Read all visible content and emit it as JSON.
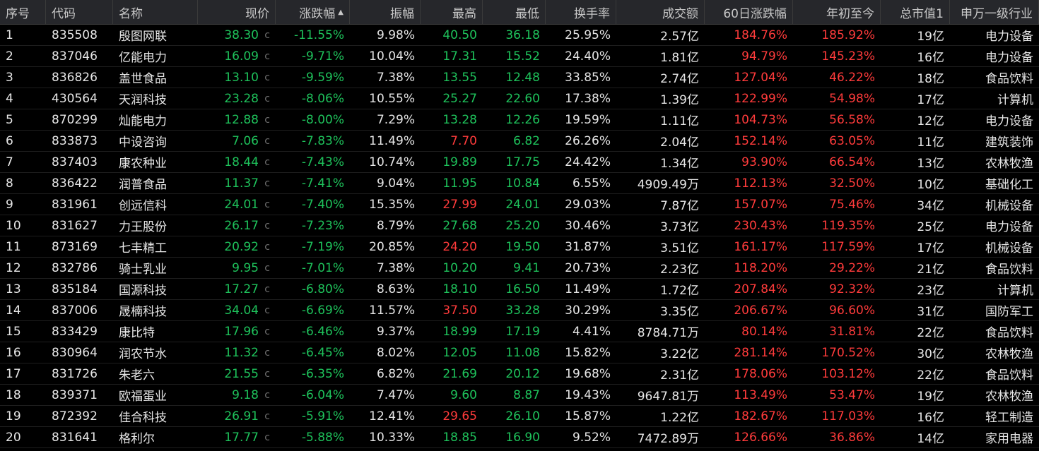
{
  "columns": {
    "idx": "序号",
    "code": "代码",
    "name": "名称",
    "price": "现价",
    "chg": "涨跌幅",
    "amp": "振幅",
    "high": "最高",
    "low": "最低",
    "turn": "换手率",
    "vol": "成交额",
    "d60": "60日涨跌幅",
    "ytd": "年初至今",
    "cap": "总市值1",
    "ind": "申万一级行业"
  },
  "sort_indicator": "▲",
  "price_suffix": "c",
  "rows": [
    {
      "idx": "1",
      "code": "835508",
      "name": "殷图网联",
      "price": "38.30",
      "chg": "-11.55%",
      "amp": "9.98%",
      "high": "40.50",
      "low": "36.18",
      "turn": "25.95%",
      "vol": "2.57亿",
      "d60": "184.76%",
      "ytd": "185.92%",
      "cap": "19亿",
      "ind": "电力设备"
    },
    {
      "idx": "2",
      "code": "837046",
      "name": "亿能电力",
      "price": "16.09",
      "chg": "-9.71%",
      "amp": "10.04%",
      "high": "17.31",
      "low": "15.52",
      "turn": "24.40%",
      "vol": "1.81亿",
      "d60": "94.79%",
      "ytd": "145.23%",
      "cap": "16亿",
      "ind": "电力设备"
    },
    {
      "idx": "3",
      "code": "836826",
      "name": "盖世食品",
      "price": "13.10",
      "chg": "-9.59%",
      "amp": "7.38%",
      "high": "13.55",
      "low": "12.48",
      "turn": "33.85%",
      "vol": "2.74亿",
      "d60": "127.04%",
      "ytd": "46.22%",
      "cap": "18亿",
      "ind": "食品饮料"
    },
    {
      "idx": "4",
      "code": "430564",
      "name": "天润科技",
      "price": "23.28",
      "chg": "-8.06%",
      "amp": "10.55%",
      "high": "25.27",
      "low": "22.60",
      "turn": "17.38%",
      "vol": "1.39亿",
      "d60": "122.99%",
      "ytd": "54.98%",
      "cap": "17亿",
      "ind": "计算机"
    },
    {
      "idx": "5",
      "code": "870299",
      "name": "灿能电力",
      "price": "12.88",
      "chg": "-8.00%",
      "amp": "7.29%",
      "high": "13.28",
      "low": "12.26",
      "turn": "19.59%",
      "vol": "1.11亿",
      "d60": "104.73%",
      "ytd": "56.58%",
      "cap": "12亿",
      "ind": "电力设备"
    },
    {
      "idx": "6",
      "code": "833873",
      "name": "中设咨询",
      "price": "7.06",
      "chg": "-7.83%",
      "amp": "11.49%",
      "high": "7.70",
      "low": "6.82",
      "turn": "26.26%",
      "vol": "2.04亿",
      "d60": "152.14%",
      "ytd": "63.05%",
      "cap": "11亿",
      "ind": "建筑装饰"
    },
    {
      "idx": "7",
      "code": "837403",
      "name": "康农种业",
      "price": "18.44",
      "chg": "-7.43%",
      "amp": "10.74%",
      "high": "19.89",
      "low": "17.75",
      "turn": "24.42%",
      "vol": "1.34亿",
      "d60": "93.90%",
      "ytd": "66.54%",
      "cap": "13亿",
      "ind": "农林牧渔"
    },
    {
      "idx": "8",
      "code": "836422",
      "name": "润普食品",
      "price": "11.37",
      "chg": "-7.41%",
      "amp": "9.04%",
      "high": "11.95",
      "low": "10.84",
      "turn": "6.55%",
      "vol": "4909.49万",
      "d60": "112.13%",
      "ytd": "32.50%",
      "cap": "10亿",
      "ind": "基础化工"
    },
    {
      "idx": "9",
      "code": "831961",
      "name": "创远信科",
      "price": "24.01",
      "chg": "-7.40%",
      "amp": "15.35%",
      "high": "27.99",
      "low": "24.01",
      "turn": "29.03%",
      "vol": "7.87亿",
      "d60": "157.07%",
      "ytd": "75.46%",
      "cap": "34亿",
      "ind": "机械设备"
    },
    {
      "idx": "10",
      "code": "831627",
      "name": "力王股份",
      "price": "26.17",
      "chg": "-7.23%",
      "amp": "8.79%",
      "high": "27.68",
      "low": "25.20",
      "turn": "30.46%",
      "vol": "3.73亿",
      "d60": "230.43%",
      "ytd": "119.35%",
      "cap": "25亿",
      "ind": "电力设备"
    },
    {
      "idx": "11",
      "code": "873169",
      "name": "七丰精工",
      "price": "20.92",
      "chg": "-7.19%",
      "amp": "20.85%",
      "high": "24.20",
      "low": "19.50",
      "turn": "31.87%",
      "vol": "3.51亿",
      "d60": "161.17%",
      "ytd": "117.59%",
      "cap": "17亿",
      "ind": "机械设备"
    },
    {
      "idx": "12",
      "code": "832786",
      "name": "骑士乳业",
      "price": "9.95",
      "chg": "-7.01%",
      "amp": "7.38%",
      "high": "10.20",
      "low": "9.41",
      "turn": "20.73%",
      "vol": "2.23亿",
      "d60": "118.20%",
      "ytd": "29.22%",
      "cap": "21亿",
      "ind": "食品饮料"
    },
    {
      "idx": "13",
      "code": "835184",
      "name": "国源科技",
      "price": "17.27",
      "chg": "-6.80%",
      "amp": "8.63%",
      "high": "18.10",
      "low": "16.50",
      "turn": "11.49%",
      "vol": "1.72亿",
      "d60": "207.84%",
      "ytd": "92.32%",
      "cap": "23亿",
      "ind": "计算机"
    },
    {
      "idx": "14",
      "code": "837006",
      "name": "晟楠科技",
      "price": "34.04",
      "chg": "-6.69%",
      "amp": "11.57%",
      "high": "37.50",
      "low": "33.28",
      "turn": "30.29%",
      "vol": "3.35亿",
      "d60": "206.67%",
      "ytd": "96.60%",
      "cap": "31亿",
      "ind": "国防军工"
    },
    {
      "idx": "15",
      "code": "833429",
      "name": "康比特",
      "price": "17.96",
      "chg": "-6.46%",
      "amp": "9.37%",
      "high": "18.99",
      "low": "17.19",
      "turn": "4.41%",
      "vol": "8784.71万",
      "d60": "80.14%",
      "ytd": "31.81%",
      "cap": "22亿",
      "ind": "食品饮料"
    },
    {
      "idx": "16",
      "code": "830964",
      "name": "润农节水",
      "price": "11.32",
      "chg": "-6.45%",
      "amp": "8.02%",
      "high": "12.05",
      "low": "11.08",
      "turn": "15.82%",
      "vol": "3.22亿",
      "d60": "281.14%",
      "ytd": "170.52%",
      "cap": "30亿",
      "ind": "农林牧渔"
    },
    {
      "idx": "17",
      "code": "831726",
      "name": "朱老六",
      "price": "21.55",
      "chg": "-6.35%",
      "amp": "6.82%",
      "high": "21.69",
      "low": "20.12",
      "turn": "19.68%",
      "vol": "2.31亿",
      "d60": "178.06%",
      "ytd": "103.12%",
      "cap": "22亿",
      "ind": "食品饮料"
    },
    {
      "idx": "18",
      "code": "839371",
      "name": "欧福蛋业",
      "price": "9.18",
      "chg": "-6.04%",
      "amp": "7.47%",
      "high": "9.60",
      "low": "8.87",
      "turn": "19.43%",
      "vol": "9647.81万",
      "d60": "113.49%",
      "ytd": "53.47%",
      "cap": "19亿",
      "ind": "农林牧渔"
    },
    {
      "idx": "19",
      "code": "872392",
      "name": "佳合科技",
      "price": "26.91",
      "chg": "-5.91%",
      "amp": "12.41%",
      "high": "29.65",
      "low": "26.10",
      "turn": "15.87%",
      "vol": "1.22亿",
      "d60": "182.67%",
      "ytd": "117.03%",
      "cap": "16亿",
      "ind": "轻工制造"
    },
    {
      "idx": "20",
      "code": "831641",
      "name": "格利尔",
      "price": "17.77",
      "chg": "-5.88%",
      "amp": "10.33%",
      "high": "18.85",
      "low": "16.90",
      "turn": "9.52%",
      "vol": "7472.89万",
      "d60": "126.66%",
      "ytd": "36.86%",
      "cap": "14亿",
      "ind": "家用电器"
    }
  ],
  "colors": {
    "down": "#1ec25b",
    "up": "#ff3b3b",
    "neutral": "#e6e6e6",
    "header_bg": "#26272b",
    "bg": "#000000"
  }
}
